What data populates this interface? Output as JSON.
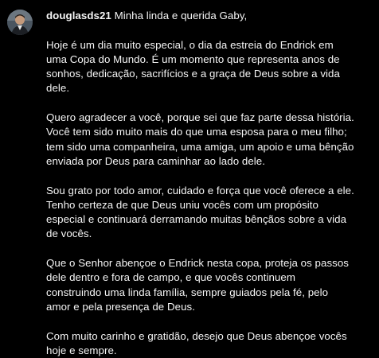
{
  "comment": {
    "username": "douglasds21",
    "greeting": "Minha linda e querida Gaby,",
    "paragraphs": [
      [
        "Hoje é um dia muito especial, o dia da estreia do Endrick em",
        "uma Copa do Mundo. É um momento que representa anos de",
        "sonhos, dedicação, sacrifícios e a graça de Deus sobre a vida",
        "dele."
      ],
      [
        "Quero agradecer a você, porque sei que faz parte dessa história.",
        "Você tem sido muito mais do que uma esposa para o meu filho;",
        "tem sido uma companheira, uma amiga, um apoio e uma bênção",
        "enviada por Deus para caminhar ao lado dele."
      ],
      [
        "Sou grato por todo amor, cuidado e força que você oferece a ele.",
        "Tenho certeza de que Deus uniu vocês com um propósito",
        "especial e continuará derramando muitas bênçãos sobre a vida",
        "de vocês."
      ],
      [
        "Que o Senhor abençoe o Endrick nesta copa, proteja os passos",
        "dele dentro e fora de campo, e que vocês continuem",
        "construindo uma linda família, sempre guiados pela fé, pelo",
        "amor e pela presença de Deus."
      ],
      [
        "Com muito carinho e gratidão, desejo que Deus abençoe vocês",
        "hoje e sempre."
      ]
    ],
    "avatar_icon": "profile-avatar"
  },
  "colors": {
    "background": "#000000",
    "text": "#f5f5f5"
  }
}
